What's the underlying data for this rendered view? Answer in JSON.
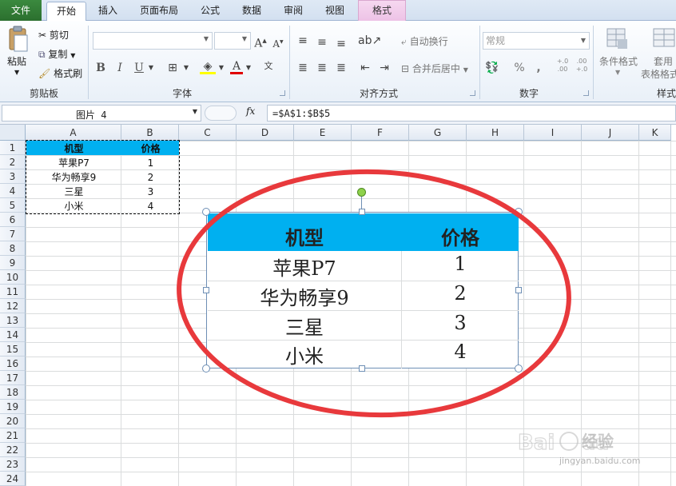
{
  "tabs": {
    "file": "文件",
    "home": "开始",
    "insert": "插入",
    "page_layout": "页面布局",
    "formulas": "公式",
    "data": "数据",
    "review": "审阅",
    "view": "视图",
    "format": "格式"
  },
  "clipboard": {
    "paste": "粘贴",
    "cut": "剪切",
    "copy": "复制",
    "format_painter": "格式刷",
    "group": "剪贴板"
  },
  "font": {
    "group": "字体",
    "bold": "B",
    "italic": "I",
    "underline": "U",
    "grow": "A",
    "shrink": "A"
  },
  "alignment": {
    "group": "对齐方式",
    "wrap_text": "自动换行",
    "merge_center": "合并后居中"
  },
  "number": {
    "group": "数字",
    "format_value": "常规",
    "percent": "%",
    "comma": ",",
    "inc_decimal": "+.0\n.00",
    "dec_decimal": ".00\n+.0"
  },
  "styles": {
    "conditional": "条件格式",
    "table_format_1": "套用",
    "table_format_2": "表格格式",
    "cell_styles": "样式"
  },
  "formula_bar": {
    "name_box": "图片 4",
    "fx": "fx",
    "formula": "=$A$1:$B$5"
  },
  "columns": [
    "A",
    "B",
    "C",
    "D",
    "E",
    "F",
    "G",
    "H",
    "I",
    "J",
    "K"
  ],
  "rows": [
    "1",
    "2",
    "3",
    "4",
    "5",
    "6",
    "7",
    "8",
    "9",
    "10",
    "11",
    "12",
    "13",
    "14",
    "15",
    "16",
    "17",
    "18",
    "19",
    "20",
    "21",
    "22",
    "23",
    "24"
  ],
  "sheet_table": {
    "headers": [
      "机型",
      "价格"
    ],
    "rows": [
      [
        "苹果P7",
        "1"
      ],
      [
        "华为畅享9",
        "2"
      ],
      [
        "三星",
        "3"
      ],
      [
        "小米",
        "4"
      ]
    ]
  },
  "picture_table": {
    "headers": [
      "机型",
      "价格"
    ],
    "rows": [
      [
        "苹果P7",
        "1"
      ],
      [
        "华为畅享9",
        "2"
      ],
      [
        "三星",
        "3"
      ],
      [
        "小米",
        "4"
      ]
    ]
  },
  "watermark": {
    "brand": "Bai du 经验",
    "url": "jingyan.baidu.com"
  },
  "colors": {
    "header_fill": "#00b0f0",
    "annotation": "#e8393c",
    "file_tab": "#2e7d32"
  }
}
